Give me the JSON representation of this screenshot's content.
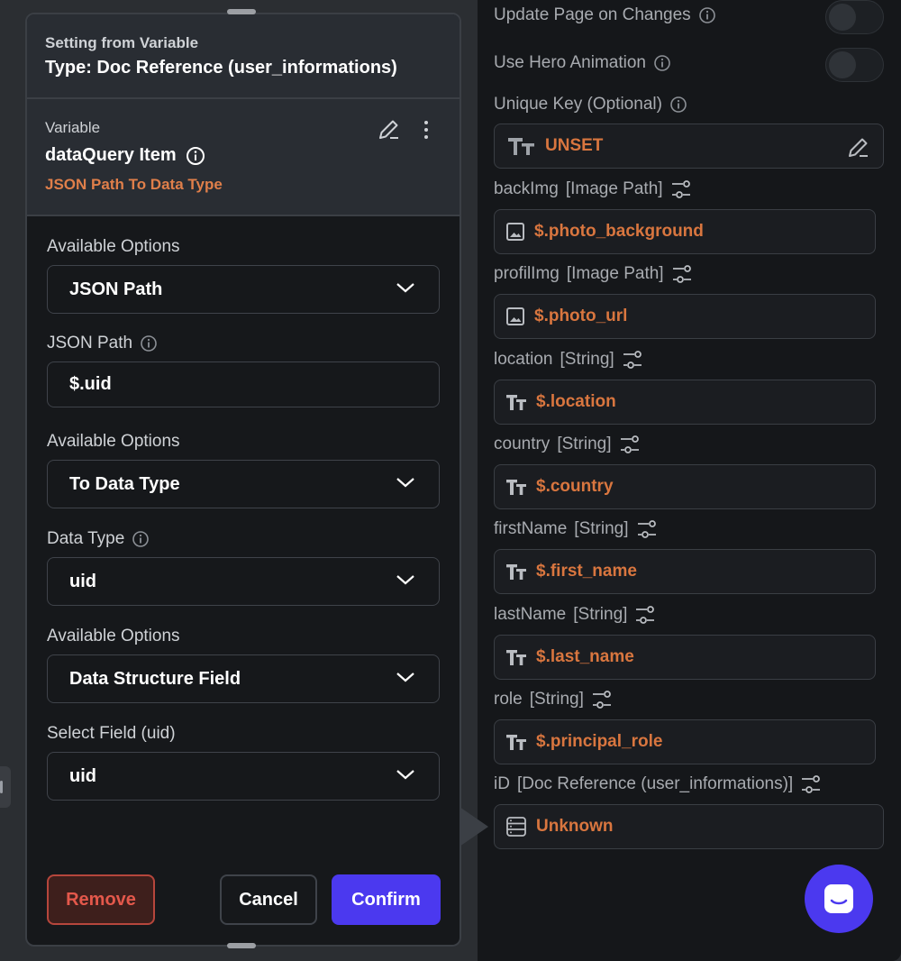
{
  "popup": {
    "header": {
      "small_label": "Setting from Variable",
      "type_label": "Type: Doc Reference (user_informations)"
    },
    "variable": {
      "label": "Variable",
      "name": "dataQuery Item",
      "subtitle": "JSON Path To Data Type"
    },
    "form": {
      "option1_label": "Available Options",
      "option1_value": "JSON Path",
      "json_path_label": "JSON Path",
      "json_path_value": "$.uid",
      "option2_label": "Available Options",
      "option2_value": "To Data Type",
      "data_type_label": "Data Type",
      "data_type_value": "uid",
      "option3_label": "Available Options",
      "option3_value": "Data Structure Field",
      "select_field_label": "Select Field (uid)",
      "select_field_value": "uid"
    },
    "buttons": {
      "remove": "Remove",
      "cancel": "Cancel",
      "confirm": "Confirm"
    }
  },
  "right_panel": {
    "update_page_label": "Update Page on Changes",
    "hero_animation_label": "Use Hero Animation",
    "unique_key_label": "Unique Key (Optional)",
    "unique_key_value": "UNSET",
    "fields": [
      {
        "name": "backImg",
        "type": "[Image Path]",
        "value": "$.photo_background",
        "icon": "image-icon"
      },
      {
        "name": "profilImg",
        "type": "[Image Path]",
        "value": "$.photo_url",
        "icon": "image-icon"
      },
      {
        "name": "location",
        "type": "[String]",
        "value": "$.location",
        "icon": "text-icon"
      },
      {
        "name": "country",
        "type": "[String]",
        "value": "$.country",
        "icon": "text-icon"
      },
      {
        "name": "firstName",
        "type": "[String]",
        "value": "$.first_name",
        "icon": "text-icon"
      },
      {
        "name": "lastName",
        "type": "[String]",
        "value": "$.last_name",
        "icon": "text-icon"
      },
      {
        "name": "role",
        "type": "[String]",
        "value": "$.principal_role",
        "icon": "text-icon"
      },
      {
        "name": "iD",
        "type": "[Doc Reference (user_informations)]",
        "value": "Unknown",
        "icon": "database-icon"
      }
    ]
  },
  "colors": {
    "accent": "#4b39ef",
    "orange": "#e07f4a",
    "danger": "#e4584b"
  }
}
